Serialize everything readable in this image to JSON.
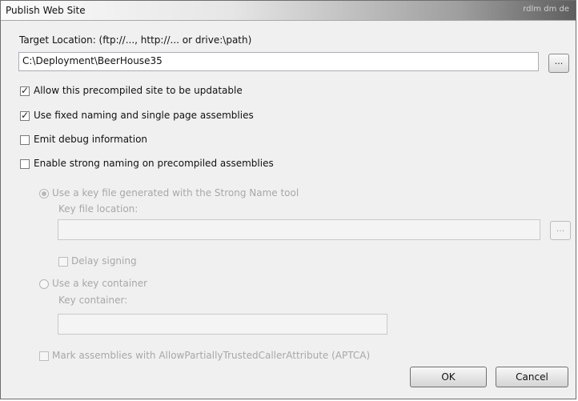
{
  "window": {
    "title": "Publish Web Site",
    "title_deco": "rdlm dm de"
  },
  "target": {
    "label": "Target Location: (ftp://..., http://... or drive:\\path)",
    "value": "C:\\Deployment\\BeerHouse35",
    "browse_label": "..."
  },
  "options": {
    "updatable": {
      "label": "Allow this precompiled site to be updatable",
      "checked": true
    },
    "fixed_naming": {
      "label": "Use fixed naming and single page assemblies",
      "checked": true
    },
    "debug_info": {
      "label": "Emit debug information",
      "checked": false
    },
    "strong_naming": {
      "label": "Enable strong naming on precompiled assemblies",
      "checked": false
    }
  },
  "strong_name": {
    "key_file_radio": "Use a key file generated with the Strong Name tool",
    "key_file_location_label": "Key file location:",
    "key_file_location_value": "",
    "key_file_browse": "...",
    "delay_signing": "Delay signing",
    "key_container_radio": "Use a key container",
    "key_container_label": "Key container:",
    "key_container_value": "",
    "aptca": "Mark assemblies with AllowPartiallyTrustedCallerAttribute (APTCA)"
  },
  "buttons": {
    "ok": "OK",
    "cancel": "Cancel"
  }
}
